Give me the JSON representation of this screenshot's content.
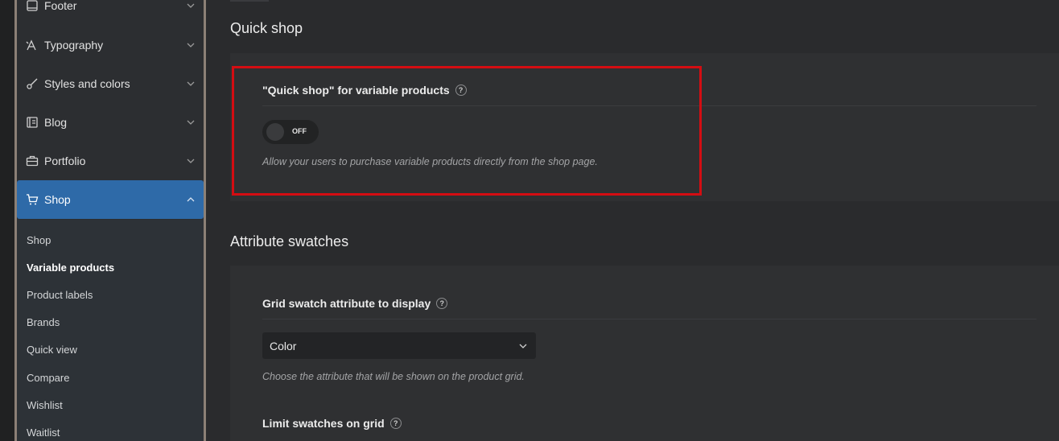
{
  "sidebar": {
    "items": [
      {
        "label": "Footer",
        "icon": "footer-icon"
      },
      {
        "label": "Typography",
        "icon": "typography-icon"
      },
      {
        "label": "Styles and colors",
        "icon": "brush-icon"
      },
      {
        "label": "Blog",
        "icon": "blog-icon"
      },
      {
        "label": "Portfolio",
        "icon": "briefcase-icon"
      },
      {
        "label": "Shop",
        "icon": "cart-icon",
        "active": true
      }
    ],
    "submenu": [
      {
        "label": "Shop"
      },
      {
        "label": "Variable products",
        "current": true
      },
      {
        "label": "Product labels"
      },
      {
        "label": "Brands"
      },
      {
        "label": "Quick view"
      },
      {
        "label": "Compare"
      },
      {
        "label": "Wishlist"
      },
      {
        "label": "Waitlist"
      }
    ]
  },
  "quick_shop": {
    "title": "Quick shop",
    "field_label": "\"Quick shop\" for variable products",
    "help": "?",
    "toggle_state": "OFF",
    "toggle_on": false,
    "description": "Allow your users to purchase variable products directly from the shop page."
  },
  "swatches": {
    "title": "Attribute swatches",
    "grid_label": "Grid swatch attribute to display",
    "help": "?",
    "selected": "Color",
    "grid_description": "Choose the attribute that will be shown on the product grid.",
    "limit_label": "Limit swatches on grid"
  },
  "colors": {
    "accent": "#2e6aa8",
    "highlight": "#d40d12"
  }
}
